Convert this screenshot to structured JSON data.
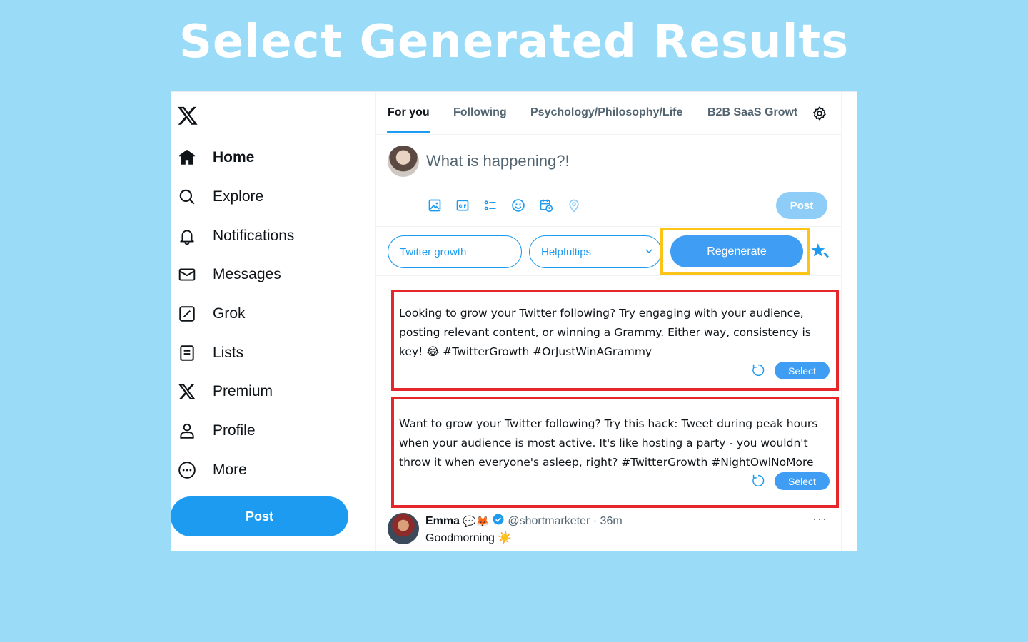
{
  "banner": {
    "title": "Select Generated Results"
  },
  "sidebar": {
    "logo_icon": "x-logo-icon",
    "items": [
      {
        "label": "Home",
        "icon": "home-icon",
        "active": true
      },
      {
        "label": "Explore",
        "icon": "search-icon"
      },
      {
        "label": "Notifications",
        "icon": "bell-icon"
      },
      {
        "label": "Messages",
        "icon": "envelope-icon"
      },
      {
        "label": "Grok",
        "icon": "grok-icon"
      },
      {
        "label": "Lists",
        "icon": "list-icon"
      },
      {
        "label": "Premium",
        "icon": "x-logo-icon"
      },
      {
        "label": "Profile",
        "icon": "person-icon"
      },
      {
        "label": "More",
        "icon": "more-circle-icon"
      }
    ],
    "post_label": "Post"
  },
  "tabs": [
    {
      "label": "For you",
      "active": true
    },
    {
      "label": "Following"
    },
    {
      "label": "Psychology/Philosophy/Life"
    },
    {
      "label": "B2B SaaS Growt"
    }
  ],
  "composer": {
    "placeholder": "What is happening?!",
    "post_label": "Post",
    "tools": [
      "image-icon",
      "gif-icon",
      "poll-icon",
      "emoji-icon",
      "schedule-icon",
      "location-icon"
    ]
  },
  "extension": {
    "topic": "Twitter growth",
    "style": "Helpfultips",
    "regenerate_label": "Regenerate",
    "highlight_color": "#fcc419"
  },
  "results": [
    {
      "text": "Looking to grow your Twitter following? Try engaging with your audience, posting relevant content, or winning a Grammy. Either way, consistency is key! 😂 #TwitterGrowth #OrJustWinAGrammy",
      "select_label": "Select"
    },
    {
      "text": "Want to grow your Twitter following? Try this hack: Tweet during peak hours when your audience is most active. It's like hosting a party - you wouldn't throw it when everyone's asleep, right? #TwitterGrowth #NightOwlNoMore",
      "select_label": "Select"
    }
  ],
  "tweet": {
    "name": "Emma",
    "badges": "💬🦊",
    "handle": "@shortmarketer · 36m",
    "body": "Goodmorning ☀️",
    "more": "···"
  },
  "colors": {
    "accent": "#1d9bf0",
    "result_border": "#e5262b",
    "background": "#9adcf8"
  }
}
